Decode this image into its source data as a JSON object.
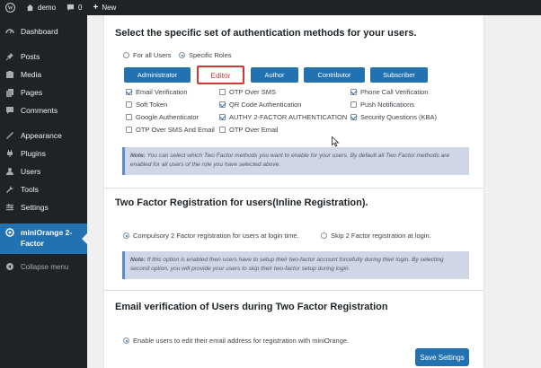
{
  "adminbar": {
    "site_name": "demo",
    "comments_count": "0",
    "new_label": "New"
  },
  "sidebar": {
    "items": [
      {
        "label": "Dashboard",
        "icon": "dashboard-icon"
      },
      {
        "label": "Posts",
        "icon": "pin-icon"
      },
      {
        "label": "Media",
        "icon": "media-icon"
      },
      {
        "label": "Pages",
        "icon": "pages-icon"
      },
      {
        "label": "Comments",
        "icon": "comments-icon"
      },
      {
        "label": "Appearance",
        "icon": "brush-icon"
      },
      {
        "label": "Plugins",
        "icon": "plugin-icon"
      },
      {
        "label": "Users",
        "icon": "users-icon"
      },
      {
        "label": "Tools",
        "icon": "wrench-icon"
      },
      {
        "label": "Settings",
        "icon": "settings-icon"
      },
      {
        "label": "miniOrange 2-\nFactor",
        "icon": "miniorange-icon"
      },
      {
        "label": "Collapse menu",
        "icon": "collapse-icon"
      }
    ]
  },
  "section1": {
    "title": "Select the specific set of authentication methods for your users.",
    "radio_all": "For all Users",
    "radio_roles": "Specific Roles",
    "roles": [
      "Administrator",
      "Editor",
      "Author",
      "Contributor",
      "Subscriber"
    ],
    "selected_role": "Editor",
    "methods": [
      {
        "label": "Email Verification",
        "checked": true
      },
      {
        "label": "OTP Over SMS",
        "checked": false
      },
      {
        "label": "Phone Call Verification",
        "checked": true
      },
      {
        "label": "Soft Token",
        "checked": false
      },
      {
        "label": "QR Code Authentication",
        "checked": true
      },
      {
        "label": "Push Notifications",
        "checked": false
      },
      {
        "label": "Google Authenticator",
        "checked": false
      },
      {
        "label": "AUTHY 2-FACTOR AUTHENTICATION",
        "checked": true
      },
      {
        "label": "Security Questions (KBA)",
        "checked": true
      },
      {
        "label": "OTP Over SMS And Email",
        "checked": false
      },
      {
        "label": "OTP Over Email",
        "checked": false
      }
    ],
    "note_label": "Note:",
    "note_text": " You can select which Two Factor methods you want to enable for your users. By default all Two Factor methods are enabled for all users of the role you have selected above."
  },
  "section2": {
    "title": "Two Factor Registration for users(Inline Registration).",
    "option_compulsory": "Compulsory 2 Factor registration for users at login time.",
    "option_skip": "Skip 2 Factor registration at login.",
    "note_label": "Note:",
    "note_text": " If this option is enabled then users have to setup their two-factor account forcefully during their login. By selecting second option, you will provide your users to skip their two-factor setup during login."
  },
  "section3": {
    "title": "Email verification of Users during Two Factor Registration",
    "option_text": "Enable users to edit their email address for registration with miniOrange."
  },
  "save_button": "Save Settings",
  "colors": {
    "accent": "#2271b1",
    "sidebar_bg": "#1d2327",
    "highlight_red": "#d63638",
    "note_bg": "#cfd7e6"
  }
}
